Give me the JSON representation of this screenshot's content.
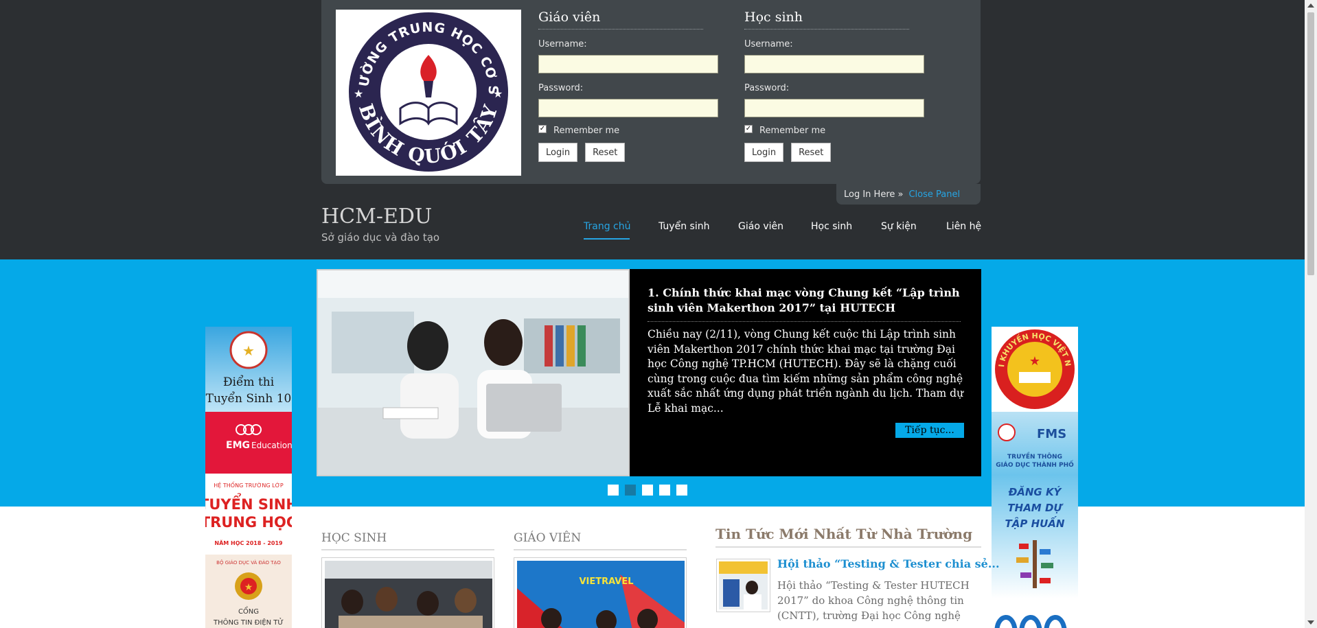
{
  "login": {
    "teacher": {
      "heading": "Giáo viên",
      "username_label": "Username:",
      "password_label": "Password:",
      "remember_label": "Remember me",
      "login_label": "Login",
      "reset_label": "Reset"
    },
    "student": {
      "heading": "Học sinh",
      "username_label": "Username:",
      "password_label": "Password:",
      "remember_label": "Remember me",
      "login_label": "Login",
      "reset_label": "Reset"
    },
    "panel_tab": {
      "label": "Log In Here »",
      "close_label": "Close Panel"
    },
    "logo": {
      "ring_text": "TRƯỜNG TRUNG HỌC CƠ SỞ",
      "name_text": "BÌNH QUỚI TÂY"
    }
  },
  "brand": {
    "title": "HCM-EDU",
    "subtitle": "Sở giáo dục và đào tạo"
  },
  "nav": {
    "items": [
      "Trang chủ",
      "Tuyển sinh",
      "Giáo viên",
      "Học sinh",
      "Sự kiện",
      "Liên hệ"
    ],
    "active_index": 0
  },
  "slider": {
    "title": "1. Chính thức khai mạc vòng Chung kết “Lập trình sinh viên Makerthon 2017” tại HUTECH",
    "body": "Chiều nay (2/11), vòng Chung kết cuộc thi Lập trình sinh viên Makerthon 2017 chính thức khai mạc tại trường Đại học Công nghệ TP.HCM (HUTECH). Đây sẽ là chặng cuối cùng trong cuộc đua tìm kiếm những sản phẩm công nghệ xuất sắc nhất ứng dụng phát triển ngành du lịch.   Tham dự Lễ khai mạc...",
    "more_label": "Tiếp tục...",
    "dot_count": 5,
    "active_dot": 1
  },
  "left_banners": [
    {
      "line1": "Điểm thi",
      "line2": "Tuyển Sinh 10"
    },
    {
      "line1": "EMG",
      "line2": "Education"
    },
    {
      "line1": "HỆ THỐNG TRƯỜNG LỚP",
      "line2": "TUYỂN SINH",
      "line3": "TRUNG HỌC",
      "line4": "NĂM HỌC 2018 - 2019"
    },
    {
      "line1": "BỘ GIÁO DỤC VÀ ĐÀO TẠO",
      "line2": "CỔNG",
      "line3": "THÔNG TIN ĐIỆN TỬ"
    }
  ],
  "right_banners": [
    {
      "line1": "HỘI KHUYẾN HỌC VIỆT NAM"
    },
    {
      "line1": "FMS",
      "line2": "TRUYỀN THÔNG",
      "line3": "GIÁO DỤC THÀNH PHỐ"
    },
    {
      "line1": "ĐĂNG KÝ",
      "line2": "THAM DỰ",
      "line3": "TẬP HUẤN"
    }
  ],
  "sections": {
    "students": {
      "heading": "HỌC SINH"
    },
    "teachers": {
      "heading": "GIÁO VIÊN",
      "photo_text": "VIETRAVEL"
    }
  },
  "news": {
    "heading": "Tin Tức Mới Nhất Từ Nhà Trường",
    "item_title": "Hội thảo “Testing & Tester  chia sẻ...",
    "item_excerpt": "Hội thảo “Testing & Tester HUTECH 2017” do khoa Công nghệ thông tin (CNTT), trường Đại học Công nghệ"
  },
  "colors": {
    "accent": "#26a5e4",
    "band_blue": "#05a9e8",
    "dark_bg": "#2c2f32",
    "panel_bg": "#41474b"
  }
}
